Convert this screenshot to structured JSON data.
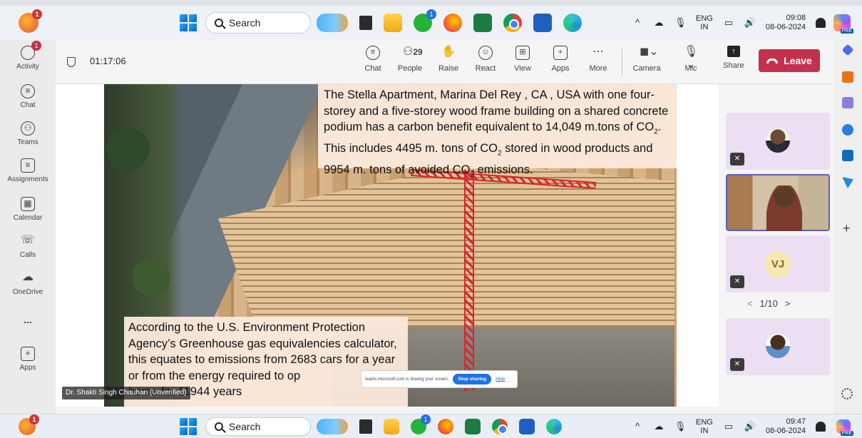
{
  "taskbar_top": {
    "notification_badge": "1",
    "search_label": "Search",
    "whatsapp_badge": "1",
    "lang_line1": "ENG",
    "lang_line2": "IN",
    "time": "09:08",
    "date": "08-06-2024",
    "copilot_badge": "PRE"
  },
  "taskbar_bottom": {
    "notification_badge": "1",
    "search_label": "Search",
    "whatsapp_badge": "1",
    "lang_line1": "ENG",
    "lang_line2": "IN",
    "time": "09:47",
    "date": "08-06-2024",
    "copilot_badge": "PRE"
  },
  "rail": {
    "items": [
      {
        "label": "Activity",
        "badge": "1"
      },
      {
        "label": "Chat"
      },
      {
        "label": "Teams"
      },
      {
        "label": "Assignments"
      },
      {
        "label": "Calendar"
      },
      {
        "label": "Calls"
      },
      {
        "label": "OneDrive"
      },
      {
        "label": "..."
      },
      {
        "label": "Apps"
      }
    ]
  },
  "meeting": {
    "timer": "01:17:06",
    "tools": {
      "chat": "Chat",
      "people": "People",
      "people_count": "29",
      "raise": "Raise",
      "react": "React",
      "view": "View",
      "apps": "Apps",
      "more": "More",
      "camera": "Camera",
      "mic": "Mic",
      "share": "Share"
    },
    "leave_label": "Leave"
  },
  "slide": {
    "top_text_a": "The Stella Apartment,  Marina Del Rey , CA , USA with one four-storey and a five-storey wood frame building on a shared concrete podium has a carbon benefit equivalent to 14,049 m.tons of CO",
    "top_text_b": ".  This includes 4495 m. tons of CO",
    "top_text_c": "  stored in wood products and 9954 m. tons of avoided CO",
    "top_text_d": " emissions.",
    "subscript": "2",
    "bottom_text_a": "According to the U.S. Environment Protection Agency’s Greenhouse gas equivalencies calculator, this equates to emissions from 2683 cars for a year or from the energy  required to op",
    "bottom_text_b": "4 years",
    "bottom_text_hidden": "home for 1194"
  },
  "speaker_tag": "Dr. Shakti Singh Chauhan (Unverified)",
  "share_bar": {
    "message": "teams.microsoft.com is sharing your screen.",
    "stop_label": "Stop sharing",
    "hide_label": "Hide"
  },
  "participants": {
    "vj_initials": "VJ",
    "pager": "1/10",
    "prev": "<",
    "next": ">"
  }
}
